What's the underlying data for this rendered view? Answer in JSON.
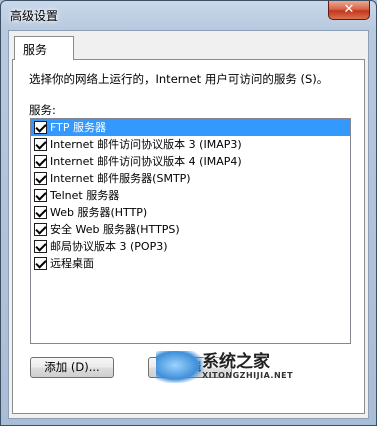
{
  "window": {
    "title": "高级设置",
    "close_glyph": "✕"
  },
  "tabs": [
    {
      "label": "服务",
      "active": true
    }
  ],
  "panel": {
    "description": "选择你的网络上运行的，Internet 用户可访问的服务 (S)。",
    "services_label": "服务:",
    "services": [
      {
        "label": "FTP 服务器",
        "checked": true,
        "selected": true
      },
      {
        "label": "Internet 邮件访问协议版本 3 (IMAP3)",
        "checked": true,
        "selected": false
      },
      {
        "label": "Internet 邮件访问协议版本 4 (IMAP4)",
        "checked": true,
        "selected": false
      },
      {
        "label": "Internet 邮件服务器(SMTP)",
        "checked": true,
        "selected": false
      },
      {
        "label": "Telnet 服务器",
        "checked": true,
        "selected": false
      },
      {
        "label": "Web 服务器(HTTP)",
        "checked": true,
        "selected": false
      },
      {
        "label": "安全 Web 服务器(HTTPS)",
        "checked": true,
        "selected": false
      },
      {
        "label": "邮局协议版本 3 (POP3)",
        "checked": true,
        "selected": false
      },
      {
        "label": "远程桌面",
        "checked": true,
        "selected": false
      }
    ]
  },
  "buttons": {
    "add_label": "添加 (D)...",
    "edit_label": "编辑"
  },
  "watermark": {
    "text": "系统之家",
    "url": "XITONGZHIJIA.NET"
  }
}
